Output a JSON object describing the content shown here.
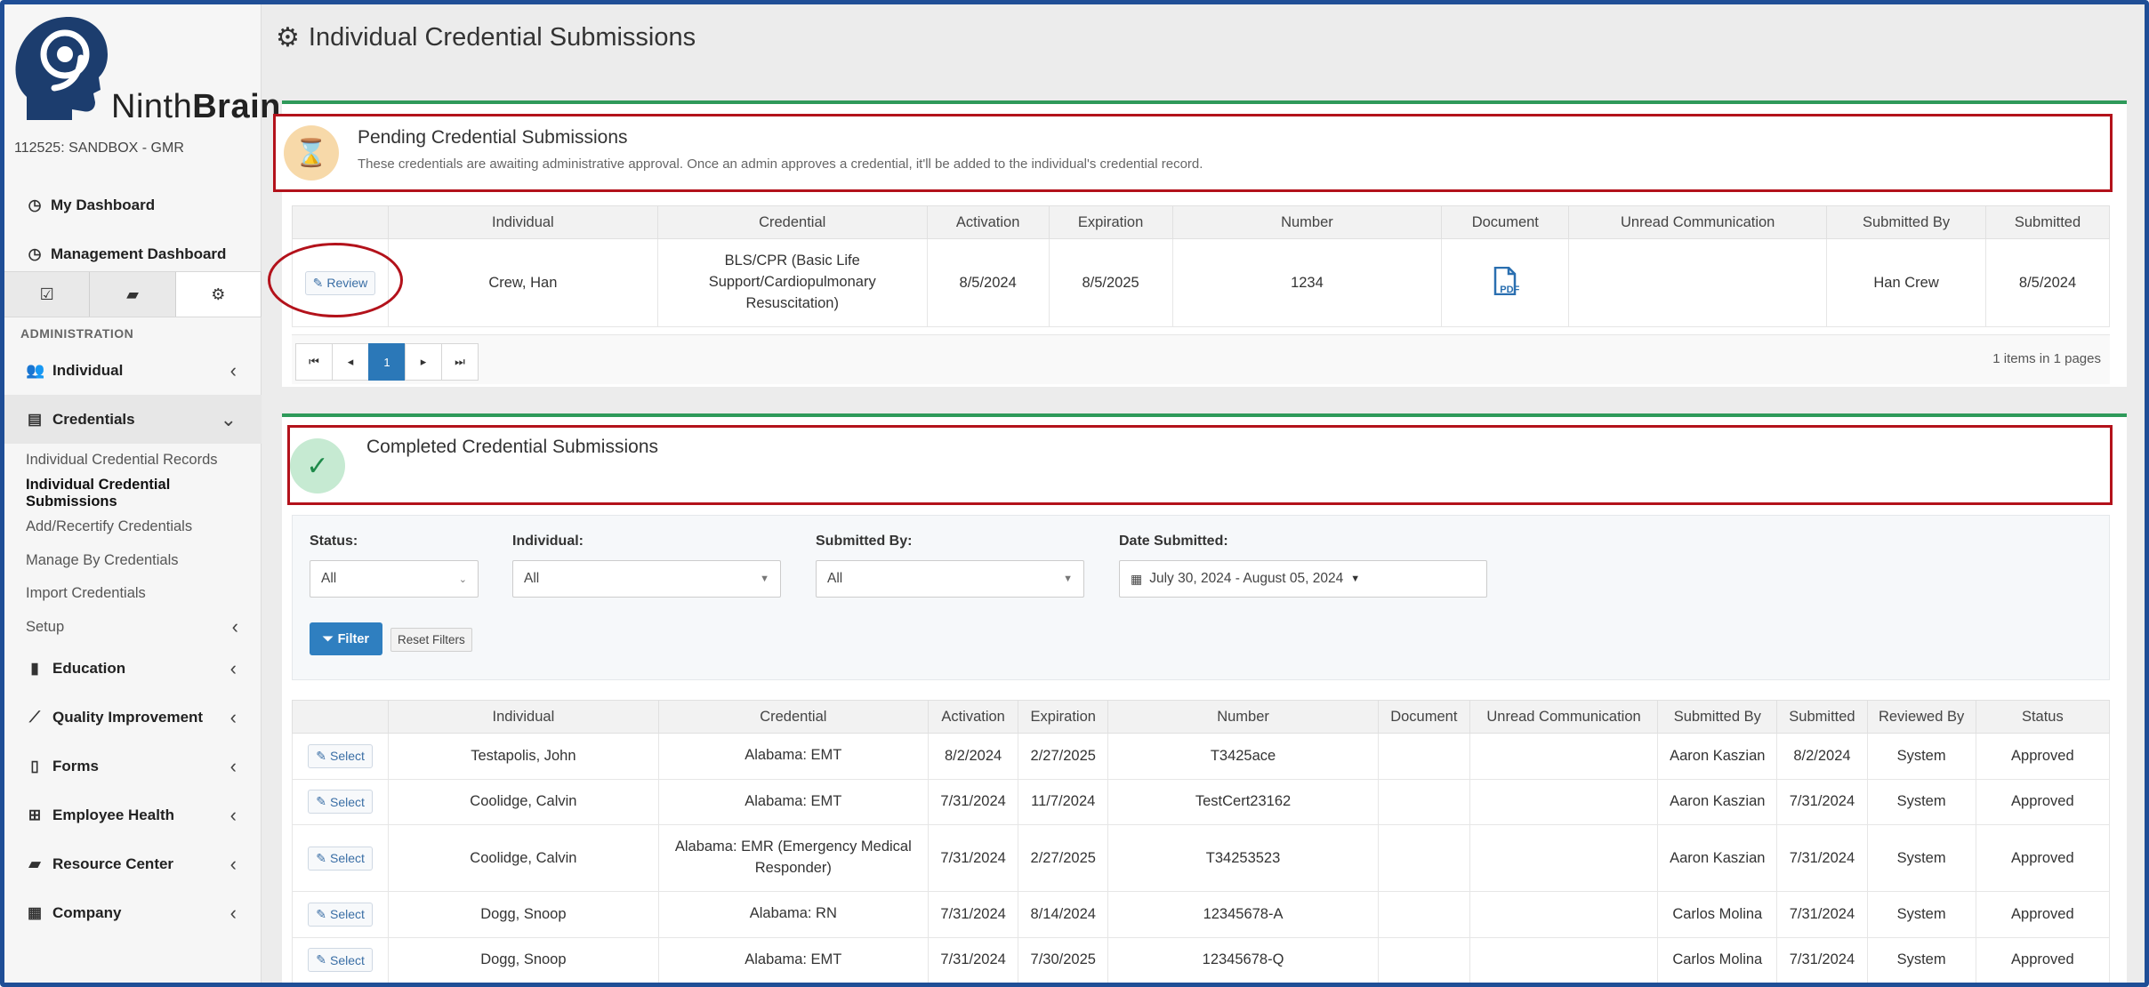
{
  "app": {
    "brand_light": "Ninth",
    "brand_bold": "Brain",
    "org": "112525: SANDBOX - GMR"
  },
  "sidebar": {
    "top_items": [
      {
        "label": "My Dashboard",
        "icon": "dashboard-icon"
      },
      {
        "label": "Management Dashboard",
        "icon": "dashboard-icon"
      }
    ],
    "tabs": [
      {
        "icon": "checkbox-icon",
        "glyph": "☑"
      },
      {
        "icon": "folder-icon",
        "glyph": "📂"
      },
      {
        "icon": "gears-icon",
        "glyph": "⚙"
      }
    ],
    "section": "ADMINISTRATION",
    "menu": [
      {
        "label": "Individual",
        "icon": "users-icon",
        "glyph": "👥"
      },
      {
        "label": "Credentials",
        "icon": "id-card-icon",
        "glyph": "▤"
      },
      {
        "label": "Education",
        "icon": "book-icon",
        "glyph": "📘"
      },
      {
        "label": "Quality Improvement",
        "icon": "chart-line-icon",
        "glyph": "📈"
      },
      {
        "label": "Forms",
        "icon": "file-icon",
        "glyph": "📄"
      },
      {
        "label": "Employee Health",
        "icon": "medkit-icon",
        "glyph": "🧰"
      },
      {
        "label": "Resource Center",
        "icon": "folder-open-icon",
        "glyph": "📂"
      },
      {
        "label": "Company",
        "icon": "building-icon",
        "glyph": "🏢"
      }
    ],
    "credentials_sub": [
      "Individual Credential Records",
      "Individual Credential Submissions",
      "Add/Recertify Credentials",
      "Manage By Credentials",
      "Import Credentials",
      "Setup"
    ]
  },
  "page": {
    "title": "Individual Credential Submissions"
  },
  "pending": {
    "title": "Pending Credential Submissions",
    "description": "These credentials are awaiting administrative approval. Once an admin approves a credential, it'll be added to the individual's credential record.",
    "columns": [
      "Individual",
      "Credential",
      "Activation",
      "Expiration",
      "Number",
      "Document",
      "Unread Communication",
      "Submitted By",
      "Submitted"
    ],
    "action_label": "Review",
    "rows": [
      {
        "individual": "Crew, Han",
        "credential": "BLS/CPR (Basic Life Support/Cardiopulmonary Resuscitation)",
        "activation": "8/5/2024",
        "expiration": "8/5/2025",
        "number": "1234",
        "document": "PDF",
        "unread": "",
        "submitted_by": "Han Crew",
        "submitted": "8/5/2024"
      }
    ],
    "pager": {
      "current_page": "1",
      "info": "1 items in 1 pages"
    }
  },
  "completed": {
    "title": "Completed Credential Submissions",
    "filters": {
      "status_label": "Status:",
      "status_value": "All",
      "individual_label": "Individual:",
      "individual_value": "All",
      "submitted_by_label": "Submitted By:",
      "submitted_by_value": "All",
      "date_label": "Date Submitted:",
      "date_value": "July 30, 2024 - August 05, 2024",
      "filter_button": "Filter",
      "reset_button": "Reset Filters"
    },
    "columns": [
      "Individual",
      "Credential",
      "Activation",
      "Expiration",
      "Number",
      "Document",
      "Unread Communication",
      "Submitted By",
      "Submitted",
      "Reviewed By",
      "Status"
    ],
    "action_label": "Select",
    "rows": [
      {
        "individual": "Testapolis, John",
        "credential": "Alabama: EMT",
        "activation": "8/2/2024",
        "expiration": "2/27/2025",
        "number": "T3425ace",
        "document": "",
        "unread": "",
        "submitted_by": "Aaron Kaszian",
        "submitted": "8/2/2024",
        "reviewed_by": "System",
        "status": "Approved"
      },
      {
        "individual": "Coolidge, Calvin",
        "credential": "Alabama: EMT",
        "activation": "7/31/2024",
        "expiration": "11/7/2024",
        "number": "TestCert23162",
        "document": "",
        "unread": "",
        "submitted_by": "Aaron Kaszian",
        "submitted": "7/31/2024",
        "reviewed_by": "System",
        "status": "Approved"
      },
      {
        "individual": "Coolidge, Calvin",
        "credential": "Alabama: EMR (Emergency Medical Responder)",
        "activation": "7/31/2024",
        "expiration": "2/27/2025",
        "number": "T34253523",
        "document": "",
        "unread": "",
        "submitted_by": "Aaron Kaszian",
        "submitted": "7/31/2024",
        "reviewed_by": "System",
        "status": "Approved"
      },
      {
        "individual": "Dogg, Snoop",
        "credential": "Alabama: RN",
        "activation": "7/31/2024",
        "expiration": "8/14/2024",
        "number": "12345678-A",
        "document": "",
        "unread": "",
        "submitted_by": "Carlos Molina",
        "submitted": "7/31/2024",
        "reviewed_by": "System",
        "status": "Approved"
      },
      {
        "individual": "Dogg, Snoop",
        "credential": "Alabama: EMT",
        "activation": "7/31/2024",
        "expiration": "7/30/2025",
        "number": "12345678-Q",
        "document": "",
        "unread": "",
        "submitted_by": "Carlos Molina",
        "submitted": "7/31/2024",
        "reviewed_by": "System",
        "status": "Approved"
      }
    ]
  },
  "colors": {
    "accent_blue": "#2b78b8",
    "success_green": "#2e9a5a",
    "highlight_red": "#b3121b",
    "pending_orange": "#d48b1b",
    "frame_blue": "#1f4e96"
  }
}
